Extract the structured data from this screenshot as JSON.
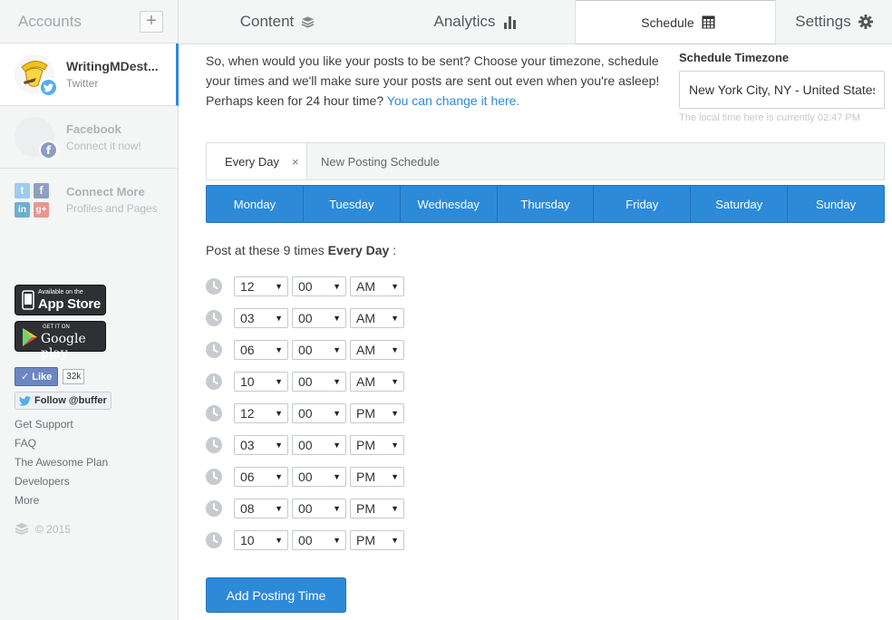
{
  "sidebar": {
    "title": "Accounts",
    "add_label": "+",
    "accounts": [
      {
        "name": "WritingMDest...",
        "sub": "Twitter"
      },
      {
        "name": "Facebook",
        "sub": "Connect it now!"
      },
      {
        "name": "Connect More",
        "sub": "Profiles and Pages"
      }
    ],
    "app_store": {
      "top": "Available on the",
      "main": "App Store"
    },
    "google_play": {
      "top": "GET IT ON",
      "main": "Google play"
    },
    "like": {
      "label": "Like",
      "count": "32k"
    },
    "follow": "Follow @buffer",
    "links": [
      "Get Support",
      "FAQ",
      "The Awesome Plan",
      "Developers",
      "More"
    ],
    "copyright": "© 2015"
  },
  "tabs": [
    {
      "label": "Content",
      "icon": "layers-icon"
    },
    {
      "label": "Analytics",
      "icon": "bar-chart-icon"
    },
    {
      "label": "Schedule",
      "icon": "calendar-icon"
    },
    {
      "label": "Settings",
      "icon": "gear-icon"
    }
  ],
  "intro": {
    "text": "So, when would you like your posts to be sent? Choose your timezone, schedule your times and we'll make sure your posts are sent out even when you're asleep!",
    "prefix": "Perhaps keen for 24 hour time? ",
    "link": "You can change it here."
  },
  "timezone": {
    "label": "Schedule Timezone",
    "value": "New York City, NY - United States",
    "hint": "The local time here is currently 02:47 PM"
  },
  "schedule_tabs": {
    "active": "Every Day",
    "close": "×",
    "new": "New Posting Schedule"
  },
  "days": [
    "Monday",
    "Tuesday",
    "Wednesday",
    "Thursday",
    "Friday",
    "Saturday",
    "Sunday"
  ],
  "post_text": {
    "prefix": "Post at these 9 times ",
    "bold": "Every Day",
    "suffix": " :"
  },
  "times": [
    {
      "h": "12",
      "m": "00",
      "ap": "AM"
    },
    {
      "h": "03",
      "m": "00",
      "ap": "AM"
    },
    {
      "h": "06",
      "m": "00",
      "ap": "AM"
    },
    {
      "h": "10",
      "m": "00",
      "ap": "AM"
    },
    {
      "h": "12",
      "m": "00",
      "ap": "PM"
    },
    {
      "h": "03",
      "m": "00",
      "ap": "PM"
    },
    {
      "h": "06",
      "m": "00",
      "ap": "PM"
    },
    {
      "h": "08",
      "m": "00",
      "ap": "PM"
    },
    {
      "h": "10",
      "m": "00",
      "ap": "PM"
    }
  ],
  "add_button": "Add Posting Time",
  "colors": {
    "accent": "#2d8ad8",
    "twitter": "#55acee",
    "facebook": "#3b5998"
  }
}
